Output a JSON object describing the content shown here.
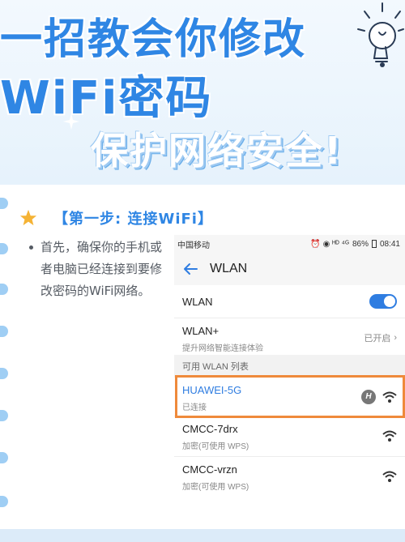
{
  "banner": {
    "line1": "一招教会你修改",
    "line2": "WiFi密码",
    "line3": "保护网络安全!"
  },
  "step": {
    "title": "【第一步: 连接WiFi】",
    "description": "首先，确保你的手机或者电脑已经连接到要修改密码的WiFi网络。"
  },
  "phone": {
    "status": {
      "carrier": "中国移动",
      "icons": "⏰ ◉ ᴴᴰ ⁴ᴳ",
      "battery": "86%",
      "time": "08:41"
    },
    "appbar_title": "WLAN",
    "wlan_label": "WLAN",
    "wlan_enabled": true,
    "wlan_plus": {
      "label": "WLAN+",
      "subtitle": "提升网络智能连接体验",
      "status": "已开启"
    },
    "section_title": "可用 WLAN 列表",
    "networks": [
      {
        "name": "HUAWEI-5G",
        "status": "已连接"
      },
      {
        "name": "CMCC-7drx",
        "status": "加密(可使用 WPS)"
      },
      {
        "name": "CMCC-vrzn",
        "status": "加密(可使用 WPS)"
      }
    ]
  },
  "colors": {
    "accent": "#2f86e4",
    "highlight": "#ef8a3b",
    "toggle_on": "#2f7de1"
  }
}
